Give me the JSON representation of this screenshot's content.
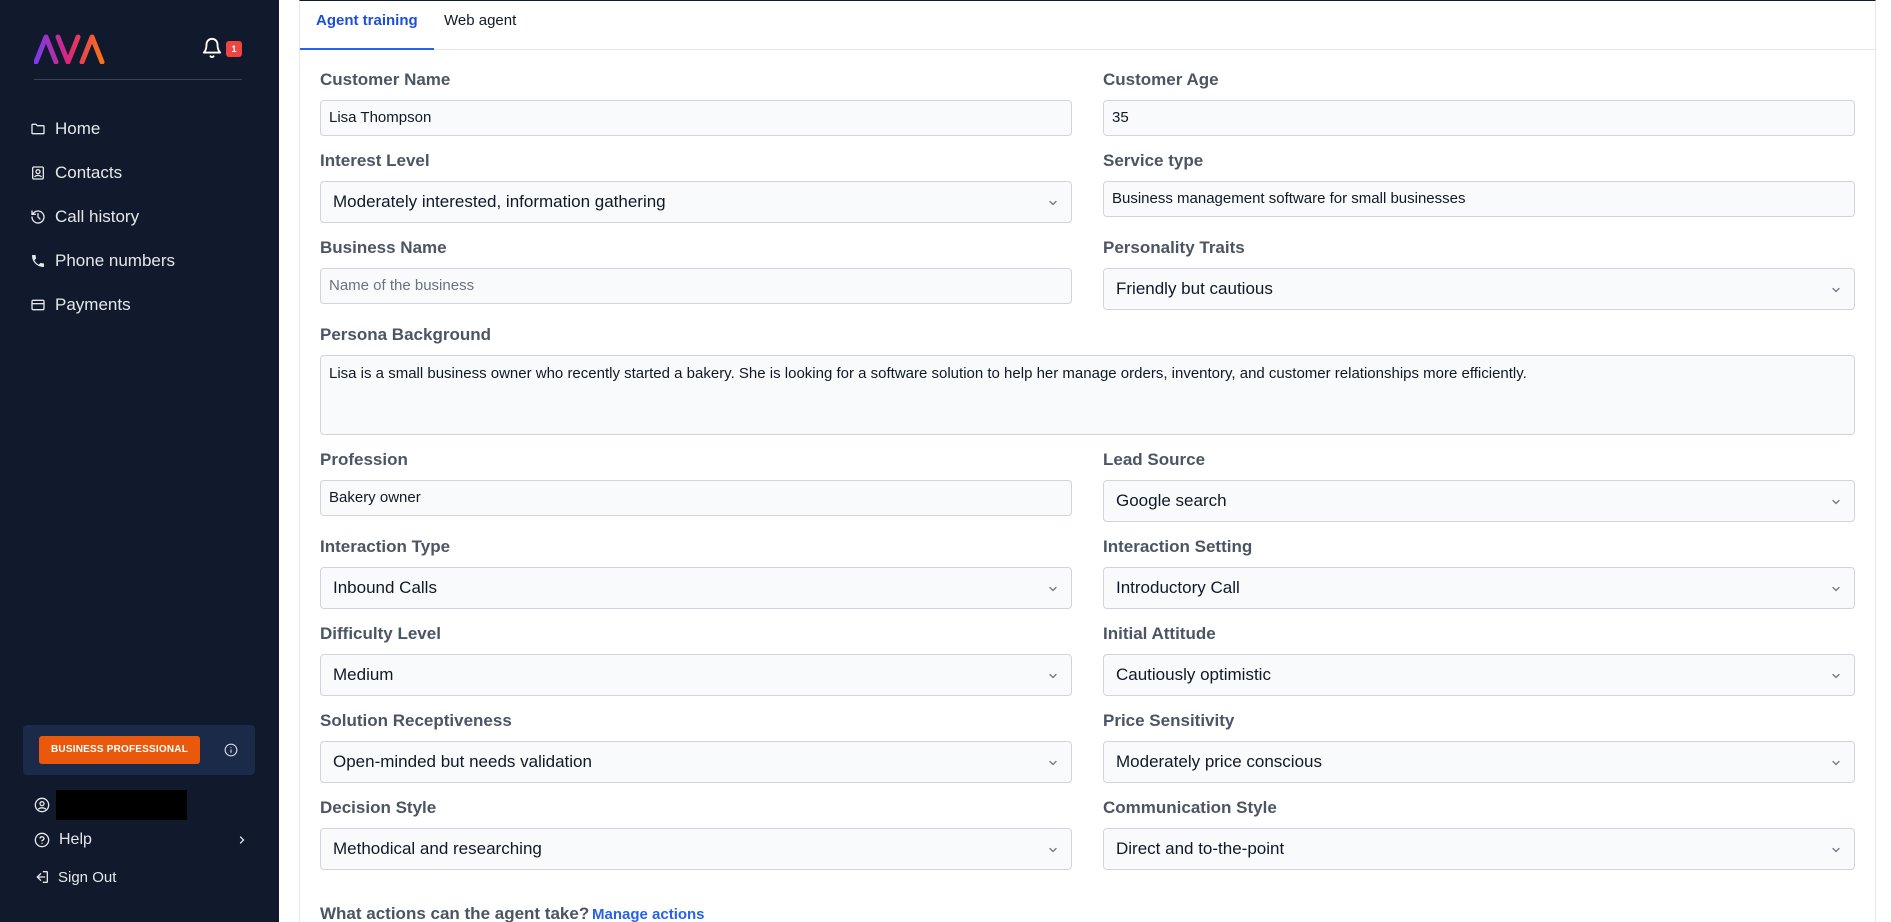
{
  "sidebar": {
    "logo_text": "AVA",
    "notification_count": "1",
    "nav": [
      {
        "label": "Home",
        "icon": "folder-icon"
      },
      {
        "label": "Contacts",
        "icon": "contact-card-icon"
      },
      {
        "label": "Call history",
        "icon": "history-icon"
      },
      {
        "label": "Phone numbers",
        "icon": "phone-icon"
      },
      {
        "label": "Payments",
        "icon": "credit-card-icon"
      }
    ],
    "plan_badge": "BUSINESS PROFESSIONAL",
    "help_label": "Help",
    "signout_label": "Sign Out"
  },
  "tabs": [
    {
      "label": "Agent training",
      "active": true
    },
    {
      "label": "Web agent",
      "active": false
    }
  ],
  "form": {
    "customer_name": {
      "label": "Customer Name",
      "value": "Lisa Thompson"
    },
    "customer_age": {
      "label": "Customer Age",
      "value": "35"
    },
    "interest_level": {
      "label": "Interest Level",
      "value": "Moderately interested, information gathering"
    },
    "service_type": {
      "label": "Service type",
      "value": "Business management software for small businesses"
    },
    "business_name": {
      "label": "Business Name",
      "placeholder": "Name of the business"
    },
    "personality_traits": {
      "label": "Personality Traits",
      "value": "Friendly but cautious"
    },
    "persona_background": {
      "label": "Persona Background",
      "value": "Lisa is a small business owner who recently started a bakery. She is looking for a software solution to help her manage orders, inventory, and customer relationships more efficiently."
    },
    "profession": {
      "label": "Profession",
      "value": "Bakery owner"
    },
    "lead_source": {
      "label": "Lead Source",
      "value": "Google search"
    },
    "interaction_type": {
      "label": "Interaction Type",
      "value": "Inbound Calls"
    },
    "interaction_setting": {
      "label": "Interaction Setting",
      "value": "Introductory Call"
    },
    "difficulty_level": {
      "label": "Difficulty Level",
      "value": "Medium"
    },
    "initial_attitude": {
      "label": "Initial Attitude",
      "value": "Cautiously optimistic"
    },
    "solution_receptiveness": {
      "label": "Solution Receptiveness",
      "value": "Open-minded but needs validation"
    },
    "price_sensitivity": {
      "label": "Price Sensitivity",
      "value": "Moderately price conscious"
    },
    "decision_style": {
      "label": "Decision Style",
      "value": "Methodical and researching"
    },
    "communication_style": {
      "label": "Communication Style",
      "value": "Direct and to-the-point"
    },
    "actions_label": "What actions can the agent take?",
    "manage_actions_label": "Manage actions"
  },
  "colors": {
    "sidebar_bg": "#111a2c",
    "accent": "#2563eb",
    "plan_badge": "#ea580c",
    "notification_badge": "#ef4444"
  }
}
